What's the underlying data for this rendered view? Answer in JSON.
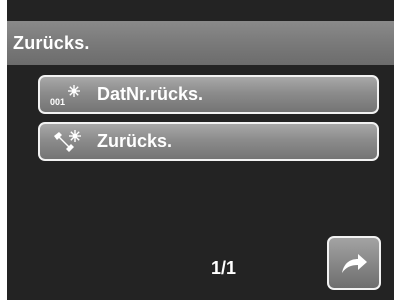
{
  "header": {
    "title": "Zurücks."
  },
  "menu": {
    "items": [
      {
        "label": "DatNr.rücks.",
        "icon": "file-number-reset-icon",
        "icon_text": "001"
      },
      {
        "label": "Zurücks.",
        "icon": "wrench-reset-icon"
      }
    ]
  },
  "footer": {
    "page_indicator": "1/1",
    "return_icon": "return-arrow-icon"
  },
  "colors": {
    "background": "#232323",
    "title_bar": "#7a7a7a",
    "item_fill": "#8c8c8c",
    "border": "#f2f2f2",
    "text": "#ffffff"
  }
}
